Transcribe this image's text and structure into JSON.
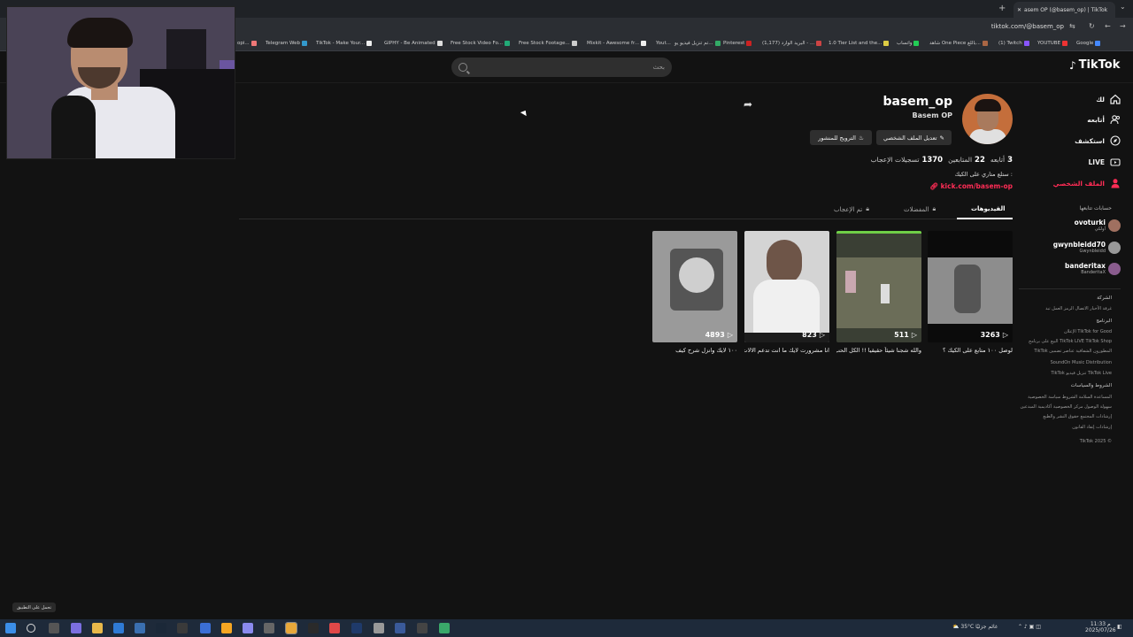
{
  "browser": {
    "tab_title": "asem OP (@basem_op) | TikTok",
    "url": "tiktok.com/@basem_op",
    "bookmarks": [
      "opi...",
      "Telegram Web",
      "TikTok - Make Your...",
      "GIPHY - Be Animated",
      "Free Stock Video Fo...",
      "Free Stock Footage...",
      "Mixkit - Awesome fr...",
      "Yout...",
      "تم تنزيل فيديو يو...",
      "Pinterest",
      "(1,177) البريد الوارد - ...",
      "1.0 Tier List and the...",
      "واتساب",
      "شاهد One Piece باللغ...",
      "(1) Twitch",
      "YOUTUBE",
      "Google"
    ]
  },
  "header": {
    "search_placeholder": "بحث",
    "logo": "TikTok"
  },
  "sidebar": {
    "nav": [
      {
        "label": "لك",
        "icon": "home-icon"
      },
      {
        "label": "أتابعه",
        "icon": "following-icon"
      },
      {
        "label": "استكشف",
        "icon": "explore-icon"
      },
      {
        "label": "LIVE",
        "icon": "live-icon"
      },
      {
        "label": "الملف الشخصي",
        "icon": "profile-icon"
      }
    ],
    "following_title": "حسابات تتابعها",
    "following": [
      {
        "name": "ovoturki",
        "sub": "أولكي"
      },
      {
        "name": "gwynbleidd70",
        "sub": "Gwynbleidd"
      },
      {
        "name": "banderitax",
        "sub": "BanderitaX"
      }
    ],
    "footer": {
      "company_title": "الشركة",
      "company_links": "غرفة الأخبار  الاتصال  الرمز العمل  تبذ",
      "program_title": "البرنامج",
      "program_links": [
        "TikTok for Good  الإعلان",
        "TikTok LIVE  TikTok Shop  البيع على  برنامج",
        "المطورون  الشفافية  عناصر تضمين TikTok",
        "SoundOn Music Distribution",
        "TikTok Live  تنزيل فيديو TikTok"
      ],
      "terms_title": "الشروط والسياسات",
      "terms_links": [
        "المساعدة  السلامة  الشروط  سياسة الخصوصية",
        "سهولة الوصول  مركز الخصوصية  أكاديمية المبدعين",
        "إرشادات المجتمع  حقوق النشر والطبع",
        "إرشادات إنفاذ القانون"
      ],
      "copyright": "© 2025 TikTok"
    }
  },
  "profile": {
    "username": "basem_op",
    "nickname": "Basem OP",
    "edit_button": "تعديل الملف الشخصي",
    "promote_button": "الترويج للمنشور",
    "following_count": "3",
    "following_label": "أتابعه",
    "followers_count": "22",
    "followers_label": "المتابعين",
    "likes_count": "1370",
    "likes_label": "تسجيلات الإعجاب",
    "bio": "ستلع متاري على الكيك :",
    "link": "kick.com/basem-op"
  },
  "tabs": {
    "videos": "الفيديوهات",
    "favorites": "المفضلات",
    "liked": "تم الإعجاب"
  },
  "videos": [
    {
      "views": "3263",
      "caption": "لوصل ١٠٠ متابع على الكيك ؟"
    },
    {
      "views": "511",
      "caption": "والله شجنا شيئاً حقيقيا !! الكل الحب"
    },
    {
      "views": "823",
      "caption": "انا مشرورت لايك ما انت تدعم الالات"
    },
    {
      "views": "4893",
      "caption": "١٠٠ لايك وانزل شرح كيف"
    }
  ],
  "toast": "تحمل على التطبيق",
  "taskbar": {
    "weather": "35°C",
    "weather_label": "غائم جزئيًا",
    "time": "11:33 م",
    "date": "2025/07/26"
  },
  "colors": {
    "accent": "#fe2c55",
    "background": "#121212"
  }
}
